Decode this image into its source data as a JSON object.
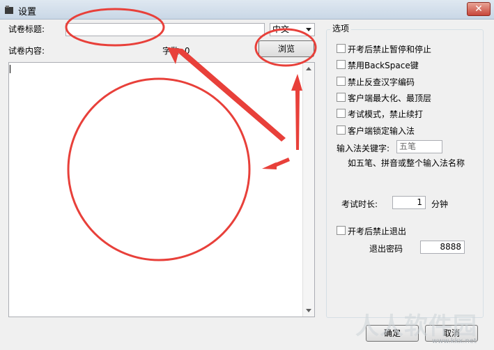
{
  "window": {
    "title": "设置",
    "close_label": "✕"
  },
  "left": {
    "title_label": "试卷标题:",
    "title_value": "",
    "language_select": "中文",
    "content_label": "试卷内容:",
    "word_count": "字数: 0",
    "browse_label": "浏览",
    "content_value": ""
  },
  "options": {
    "group_title": "选项",
    "checkboxes": [
      {
        "label": "开考后禁止暂停和停止",
        "checked": false
      },
      {
        "label": "禁用BackSpace键",
        "checked": false
      },
      {
        "label": "禁止反查汉字编码",
        "checked": false
      },
      {
        "label": "客户端最大化、最顶层",
        "checked": false
      },
      {
        "label": "考试模式，禁止续打",
        "checked": false
      },
      {
        "label": "客户端锁定输入法",
        "checked": false
      }
    ],
    "ime_label": "输入法关键字:",
    "ime_value": "五笔",
    "ime_hint": "如五笔、拼音或整个输入法名称",
    "duration_label": "考试时长:",
    "duration_value": "1",
    "duration_unit": "分钟",
    "forbid_exit_label": "开考后禁止退出",
    "forbid_exit_checked": false,
    "exit_password_label": "退出密码",
    "exit_password_value": "8888"
  },
  "footer": {
    "ok_label": "确定",
    "cancel_label": "取消"
  },
  "watermark": {
    "main": "人人软件园",
    "url": "www.kkx.net"
  },
  "colors": {
    "annotation": "#e8403a",
    "titlebar": "#c9d7e6",
    "close": "#c7463a"
  }
}
